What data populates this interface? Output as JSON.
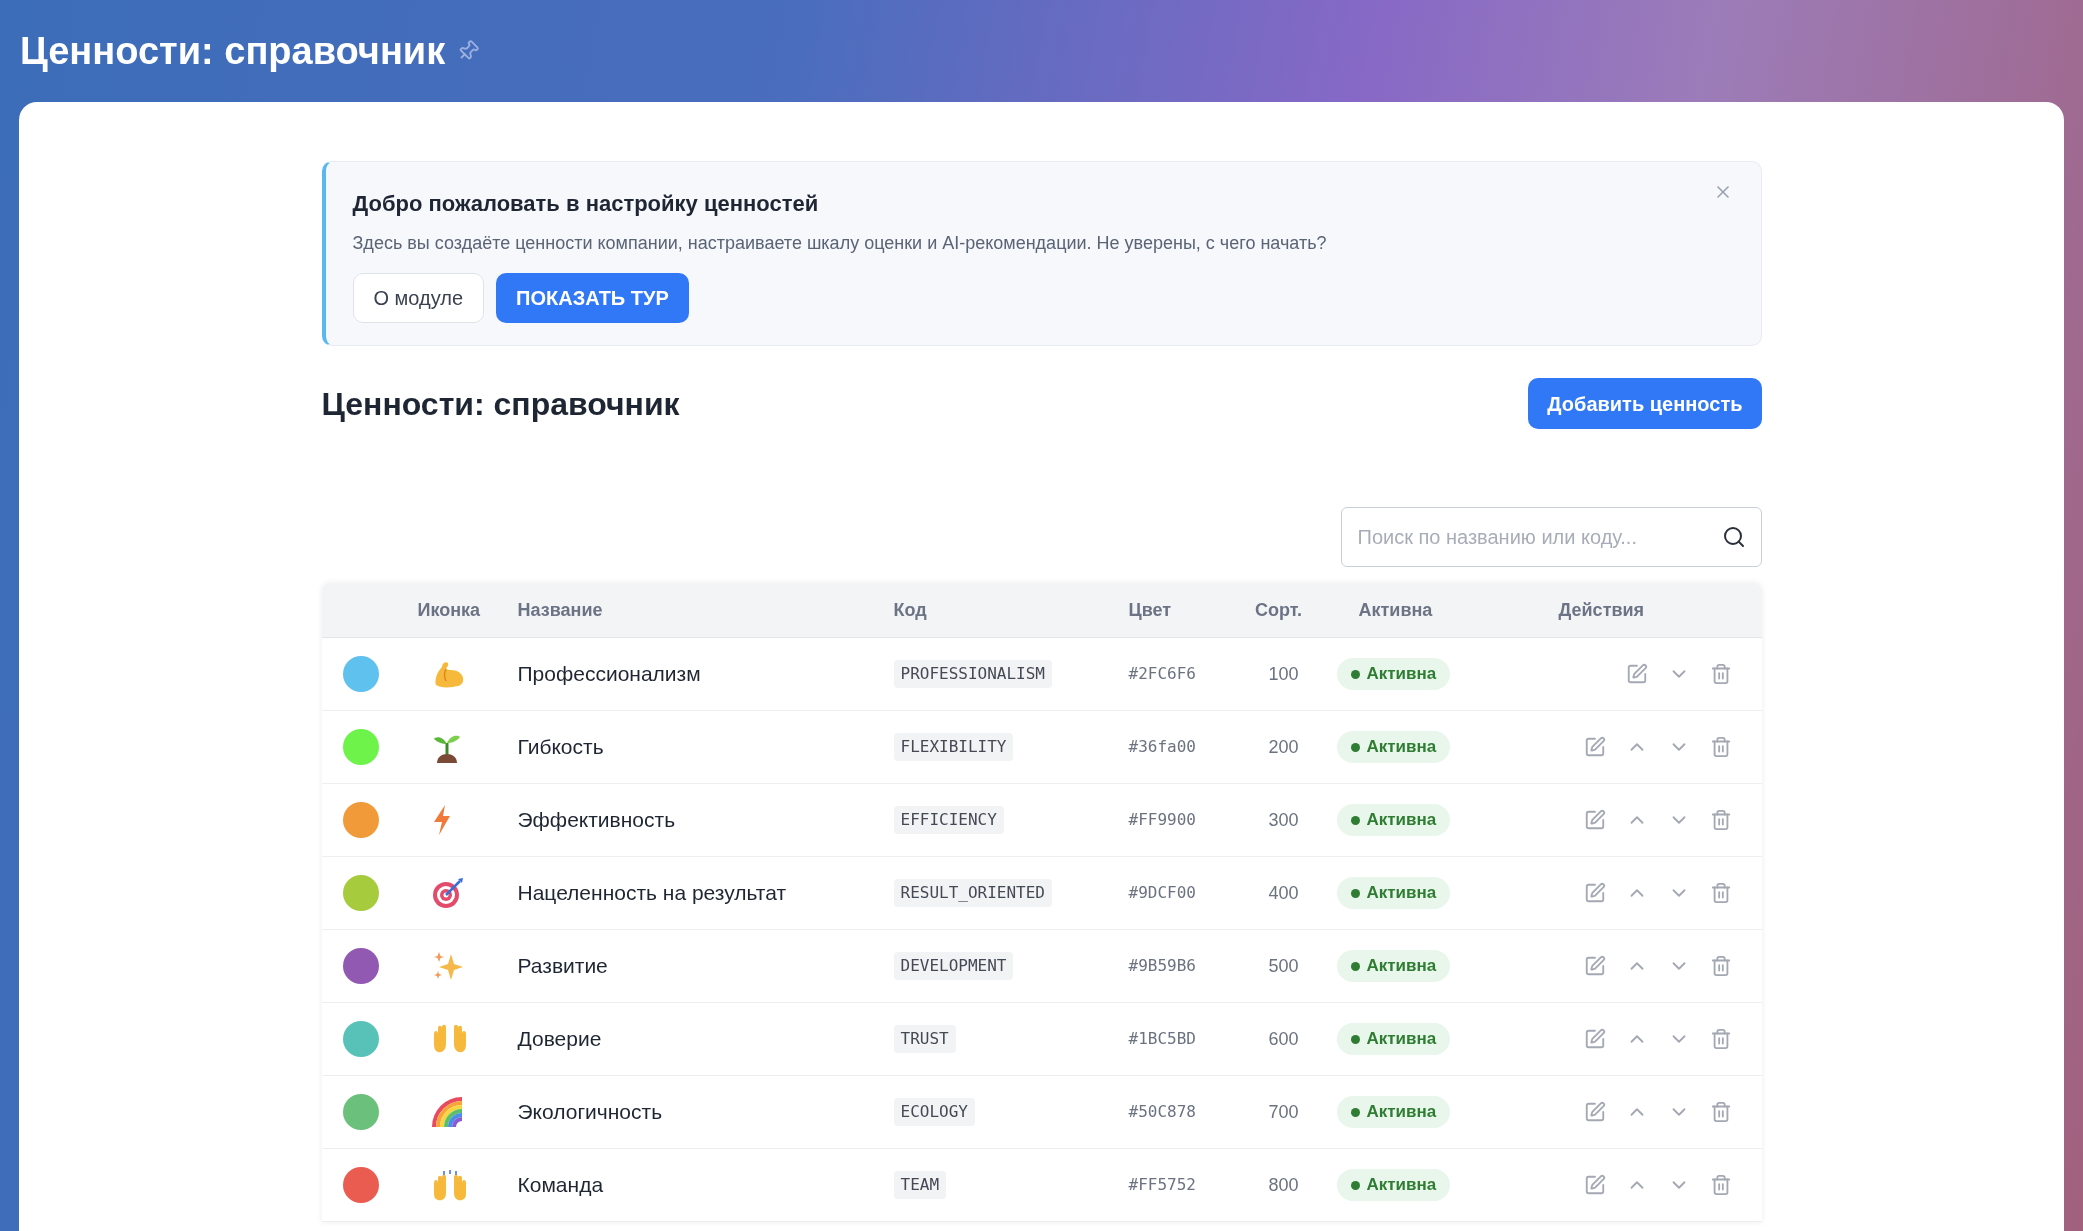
{
  "page": {
    "title": "Ценности: справочник"
  },
  "banner": {
    "title": "Добро пожаловать в настройку ценностей",
    "text": "Здесь вы создаёте ценности компании, настраиваете шкалу оценки и AI-рекомендации. Не уверены, с чего начать?",
    "buttons": [
      "О модуле",
      "ПОКАЗАТЬ ТУР"
    ]
  },
  "heading": "Ценности: справочник",
  "add_button": "Добавить ценность",
  "search": {
    "placeholder": "Поиск по названию или коду..."
  },
  "table": {
    "columns": [
      "Иконка",
      "Название",
      "Код",
      "Цвет",
      "Сорт.",
      "Активна",
      "Действия"
    ],
    "rows": [
      {
        "color": "#5fc1ee",
        "name": "Профессионализм",
        "code": "PROFESSIONALISM",
        "hex": "#2FC6F6",
        "sort": "100",
        "active": true,
        "status": "Активна",
        "move_up": false
      },
      {
        "color": "#6ef34a",
        "name": "Гибкость",
        "code": "FLEXIBILITY",
        "hex": "#36fa00",
        "sort": "200",
        "active": true,
        "status": "Активна",
        "move_up": true
      },
      {
        "color": "#f09a3a",
        "name": "Эффективность",
        "code": "EFFICIENCY",
        "hex": "#FF9900",
        "sort": "300",
        "active": true,
        "status": "Активна",
        "move_up": true
      },
      {
        "color": "#a6cc3e",
        "name": "Нацеленность на результат",
        "code": "RESULT_ORIENTED",
        "hex": "#9DCF00",
        "sort": "400",
        "active": true,
        "status": "Активна",
        "move_up": true
      },
      {
        "color": "#9159b2",
        "name": "Развитие",
        "code": "DEVELOPMENT",
        "hex": "#9B59B6",
        "sort": "500",
        "active": true,
        "status": "Активна",
        "move_up": true
      },
      {
        "color": "#58c2b8",
        "name": "Доверие",
        "code": "TRUST",
        "hex": "#1BC5BD",
        "sort": "600",
        "active": true,
        "status": "Активна",
        "move_up": true
      },
      {
        "color": "#6bc07b",
        "name": "Экологичность",
        "code": "ECOLOGY",
        "hex": "#50C878",
        "sort": "700",
        "active": true,
        "status": "Активна",
        "move_up": true
      },
      {
        "color": "#ea5b50",
        "name": "Команда",
        "code": "TEAM",
        "hex": "#FF5752",
        "sort": "800",
        "active": true,
        "status": "Активна",
        "move_up": true
      }
    ]
  }
}
